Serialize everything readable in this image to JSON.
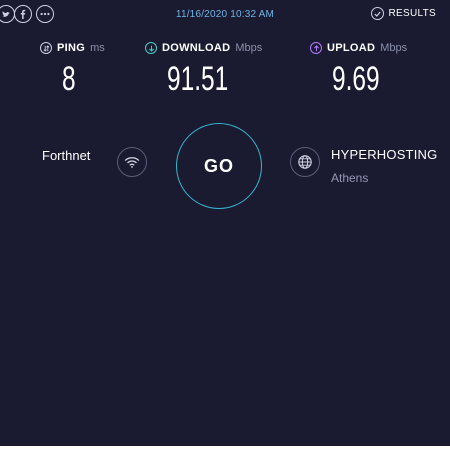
{
  "topbar": {
    "social_icons": [
      "twitter-icon",
      "facebook-icon",
      "more-icon"
    ],
    "datetime": "11/16/2020 10:32 AM",
    "results_label": "RESULTS"
  },
  "metrics": {
    "ping": {
      "label": "PING",
      "unit": "ms",
      "value": "8",
      "color": "#cfd2e6"
    },
    "download": {
      "label": "DOWNLOAD",
      "unit": "Mbps",
      "value": "91.51",
      "color": "#40d0c8"
    },
    "upload": {
      "label": "UPLOAD",
      "unit": "Mbps",
      "value": "9.69",
      "color": "#b57bff"
    }
  },
  "provider": {
    "name": "Forthnet"
  },
  "go_button": {
    "label": "GO",
    "color": "#35b6d2"
  },
  "server": {
    "name": "HYPERHOSTING",
    "location": "Athens"
  },
  "colors": {
    "background": "#1a1b30",
    "accent": "#35b6d2",
    "datetime": "#6fb3e8"
  }
}
